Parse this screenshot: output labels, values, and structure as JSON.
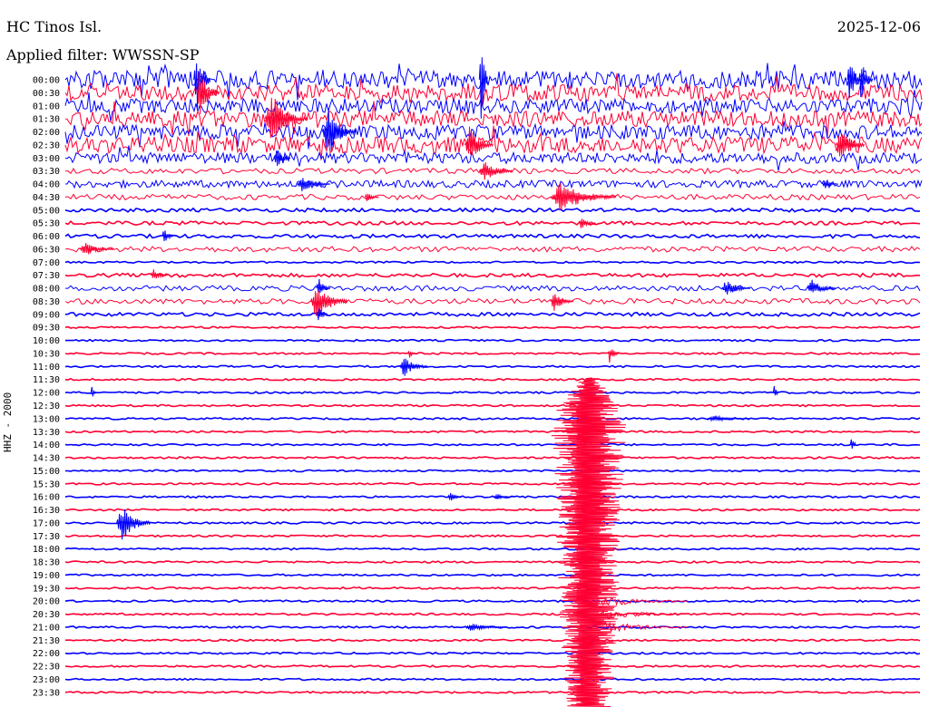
{
  "header": {
    "station": "HC Tinos Isl.",
    "date": "2025-12-06",
    "filter": "Applied filter: WWSSN-SP"
  },
  "channel_label": "HHZ - 2000",
  "colors": {
    "trace_a": "#0000ff",
    "trace_b": "#ff0033",
    "text": "#000000",
    "background": "#ffffff"
  },
  "chart_data": {
    "type": "helicorder",
    "title": "HC Tinos Isl.",
    "date": "2025-12-06",
    "subtitle": "Applied filter: WWSSN-SP",
    "ylabel": "HHZ - 2000",
    "row_minutes": 30,
    "rows": [
      "00:00",
      "00:30",
      "01:00",
      "01:30",
      "02:00",
      "02:30",
      "03:00",
      "03:30",
      "04:00",
      "04:30",
      "05:00",
      "05:30",
      "06:00",
      "06:30",
      "07:00",
      "07:30",
      "08:00",
      "08:30",
      "09:00",
      "09:30",
      "10:00",
      "10:30",
      "11:00",
      "11:30",
      "12:00",
      "12:30",
      "13:00",
      "13:30",
      "14:00",
      "14:30",
      "15:00",
      "15:30",
      "16:00",
      "16:30",
      "17:00",
      "17:30",
      "18:00",
      "18:30",
      "19:00",
      "19:30",
      "20:00",
      "20:30",
      "21:00",
      "21:30",
      "22:00",
      "22:30",
      "23:00",
      "23:30"
    ],
    "color_cycle": [
      "trace_a",
      "trace_b"
    ],
    "noise_level": [
      10,
      9,
      8,
      9,
      8,
      9,
      6,
      3,
      4,
      3,
      2,
      2,
      2,
      3,
      1,
      2,
      3,
      3,
      2,
      1,
      1,
      1,
      1,
      1,
      1,
      1,
      1,
      1,
      1,
      1,
      1,
      1,
      1,
      1,
      1,
      1,
      1,
      1,
      1,
      1,
      1,
      1,
      1,
      1,
      1,
      1,
      1,
      1
    ],
    "events": [
      {
        "row": "00:00",
        "minute": 14.5,
        "amplitude": 70,
        "duration_min": 0.3
      },
      {
        "row": "00:00",
        "minute": 27.4,
        "amplitude": 28,
        "duration_min": 0.5
      },
      {
        "row": "00:00",
        "minute": 27.8,
        "amplitude": 24,
        "duration_min": 0.5
      },
      {
        "row": "00:00",
        "minute": 4.5,
        "amplitude": 40,
        "duration_min": 0.6
      },
      {
        "row": "00:30",
        "minute": 4.6,
        "amplitude": 30,
        "duration_min": 0.8
      },
      {
        "row": "01:30",
        "minute": 7.0,
        "amplitude": 30,
        "duration_min": 1.5
      },
      {
        "row": "02:00",
        "minute": 9.0,
        "amplitude": 30,
        "duration_min": 1.2
      },
      {
        "row": "02:30",
        "minute": 14.0,
        "amplitude": 22,
        "duration_min": 1.0
      },
      {
        "row": "02:30",
        "minute": 27.0,
        "amplitude": 22,
        "duration_min": 1.0
      },
      {
        "row": "03:00",
        "minute": 7.3,
        "amplitude": 14,
        "duration_min": 0.6
      },
      {
        "row": "03:30",
        "minute": 14.5,
        "amplitude": 12,
        "duration_min": 1.2
      },
      {
        "row": "04:00",
        "minute": 8.1,
        "amplitude": 10,
        "duration_min": 1.2
      },
      {
        "row": "04:00",
        "minute": 26.5,
        "amplitude": 6,
        "duration_min": 0.6
      },
      {
        "row": "04:30",
        "minute": 17.0,
        "amplitude": 18,
        "duration_min": 2.3
      },
      {
        "row": "04:30",
        "minute": 10.5,
        "amplitude": 6,
        "duration_min": 0.5
      },
      {
        "row": "05:30",
        "minute": 18.0,
        "amplitude": 8,
        "duration_min": 0.6
      },
      {
        "row": "06:00",
        "minute": 3.4,
        "amplitude": 10,
        "duration_min": 0.4
      },
      {
        "row": "06:30",
        "minute": 0.5,
        "amplitude": 8,
        "duration_min": 1.2
      },
      {
        "row": "07:30",
        "minute": 3.0,
        "amplitude": 8,
        "duration_min": 0.6
      },
      {
        "row": "08:00",
        "minute": 8.8,
        "amplitude": 12,
        "duration_min": 0.5
      },
      {
        "row": "08:00",
        "minute": 23.0,
        "amplitude": 10,
        "duration_min": 1.0
      },
      {
        "row": "08:00",
        "minute": 26.0,
        "amplitude": 10,
        "duration_min": 1.0
      },
      {
        "row": "08:30",
        "minute": 8.6,
        "amplitude": 22,
        "duration_min": 1.3
      },
      {
        "row": "08:30",
        "minute": 17.0,
        "amplitude": 12,
        "duration_min": 0.8
      },
      {
        "row": "09:00",
        "minute": 8.8,
        "amplitude": 12,
        "duration_min": 0.4
      },
      {
        "row": "10:30",
        "minute": 19.0,
        "amplitude": 12,
        "duration_min": 0.4
      },
      {
        "row": "10:30",
        "minute": 12.0,
        "amplitude": 6,
        "duration_min": 0.3
      },
      {
        "row": "11:00",
        "minute": 11.7,
        "amplitude": 12,
        "duration_min": 1.0
      },
      {
        "row": "12:00",
        "minute": 0.9,
        "amplitude": 8,
        "duration_min": 0.2
      },
      {
        "row": "12:00",
        "minute": 24.8,
        "amplitude": 10,
        "duration_min": 0.2
      },
      {
        "row": "13:00",
        "minute": 22.5,
        "amplitude": 4,
        "duration_min": 1.5
      },
      {
        "row": "14:00",
        "minute": 27.5,
        "amplitude": 16,
        "duration_min": 0.2
      },
      {
        "row": "16:00",
        "minute": 13.4,
        "amplitude": 6,
        "duration_min": 0.5
      },
      {
        "row": "16:00",
        "minute": 15.0,
        "amplitude": 4,
        "duration_min": 0.7
      },
      {
        "row": "17:00",
        "minute": 1.8,
        "amplitude": 22,
        "duration_min": 1.2
      },
      {
        "row": "21:00",
        "minute": 14.0,
        "amplitude": 5,
        "duration_min": 1.5
      }
    ],
    "major_event": {
      "row": "13:00",
      "minute": 18.15,
      "amplitude": 90,
      "duration_min": 3.0,
      "rows_spanned": 21
    }
  }
}
